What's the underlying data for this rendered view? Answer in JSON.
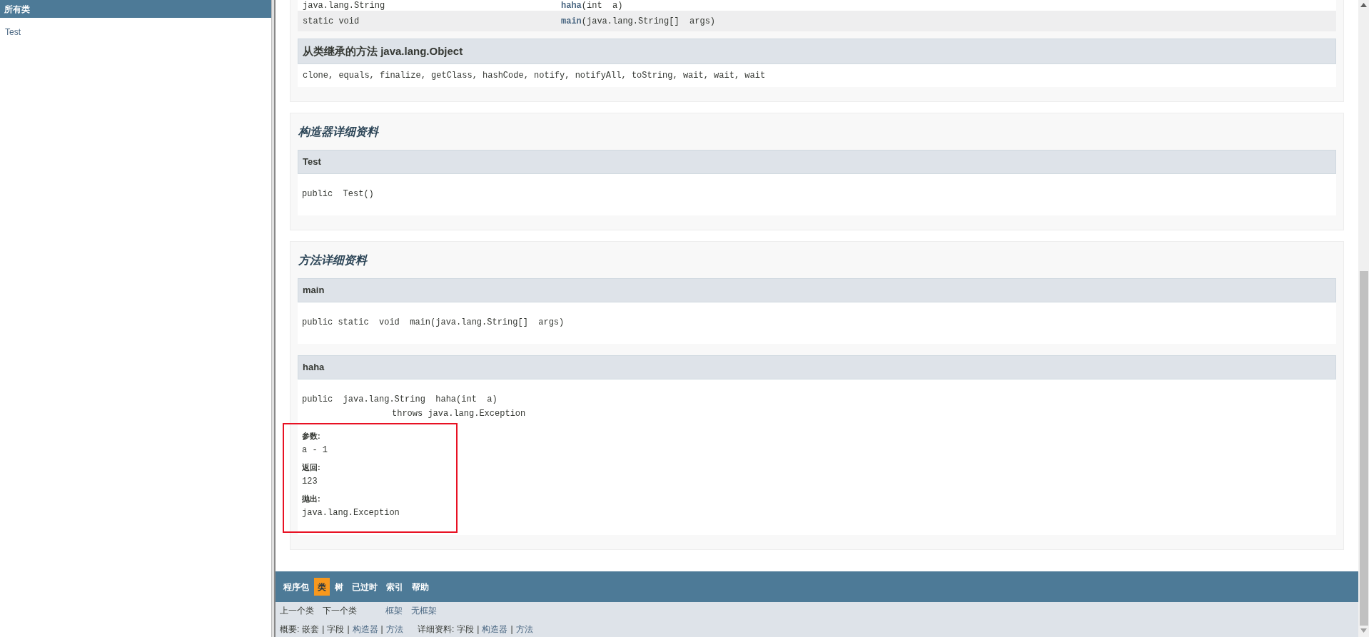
{
  "sidebar": {
    "title": "所有类",
    "items": [
      {
        "label": "Test"
      }
    ]
  },
  "method_summary": {
    "rows": [
      {
        "type": "java.lang.String",
        "method": "haha",
        "params": "(int  a)"
      },
      {
        "type": "static void",
        "method": "main",
        "params": "(java.lang.String[]  args)"
      }
    ],
    "inherited": {
      "title": "从类继承的方法 java.lang.Object",
      "methods": "clone, equals, finalize, getClass, hashCode, notify, notifyAll, toString, wait, wait, wait"
    }
  },
  "constructor_detail": {
    "title": "构造器详细资料",
    "items": [
      {
        "name": "Test",
        "signature": "public  Test()"
      }
    ]
  },
  "method_detail": {
    "title": "方法详细资料",
    "items": [
      {
        "name": "main",
        "signature": "public static  void  main(java.lang.String[]  args)"
      },
      {
        "name": "haha",
        "signature": "public  java.lang.String  haha(int  a)",
        "throws": "throws java.lang.Exception",
        "annotated": true,
        "tags": [
          {
            "label": "参数:",
            "value": "a - 1"
          },
          {
            "label": "返回:",
            "value": "123"
          },
          {
            "label": "抛出:",
            "value": "java.lang.Exception"
          }
        ]
      }
    ]
  },
  "nav": {
    "items": [
      {
        "label": "程序包",
        "selected": false
      },
      {
        "label": "类",
        "selected": true
      },
      {
        "label": "树",
        "selected": false
      },
      {
        "label": "已过时",
        "selected": false
      },
      {
        "label": "索引",
        "selected": false
      },
      {
        "label": "帮助",
        "selected": false
      }
    ]
  },
  "subnav": {
    "class_links": [
      {
        "label": "上一个类",
        "kind": "text"
      },
      {
        "label": "下一个类",
        "kind": "text"
      }
    ],
    "frame_links": [
      {
        "label": "框架",
        "kind": "link"
      },
      {
        "label": "无框架",
        "kind": "link"
      }
    ],
    "summary": [
      {
        "label": "概要:",
        "kind": "text"
      },
      {
        "label": "嵌套",
        "kind": "text"
      },
      {
        "label": "|",
        "kind": "separator"
      },
      {
        "label": "字段",
        "kind": "text"
      },
      {
        "label": "|",
        "kind": "separator"
      },
      {
        "label": "构造器",
        "kind": "link"
      },
      {
        "label": "|",
        "kind": "separator"
      },
      {
        "label": "方法",
        "kind": "link"
      }
    ],
    "detail": [
      {
        "label": "详细资料:",
        "kind": "text"
      },
      {
        "label": "字段",
        "kind": "text"
      },
      {
        "label": "|",
        "kind": "separator"
      },
      {
        "label": "构造器",
        "kind": "link"
      },
      {
        "label": "|",
        "kind": "separator"
      },
      {
        "label": "方法",
        "kind": "link"
      }
    ]
  }
}
